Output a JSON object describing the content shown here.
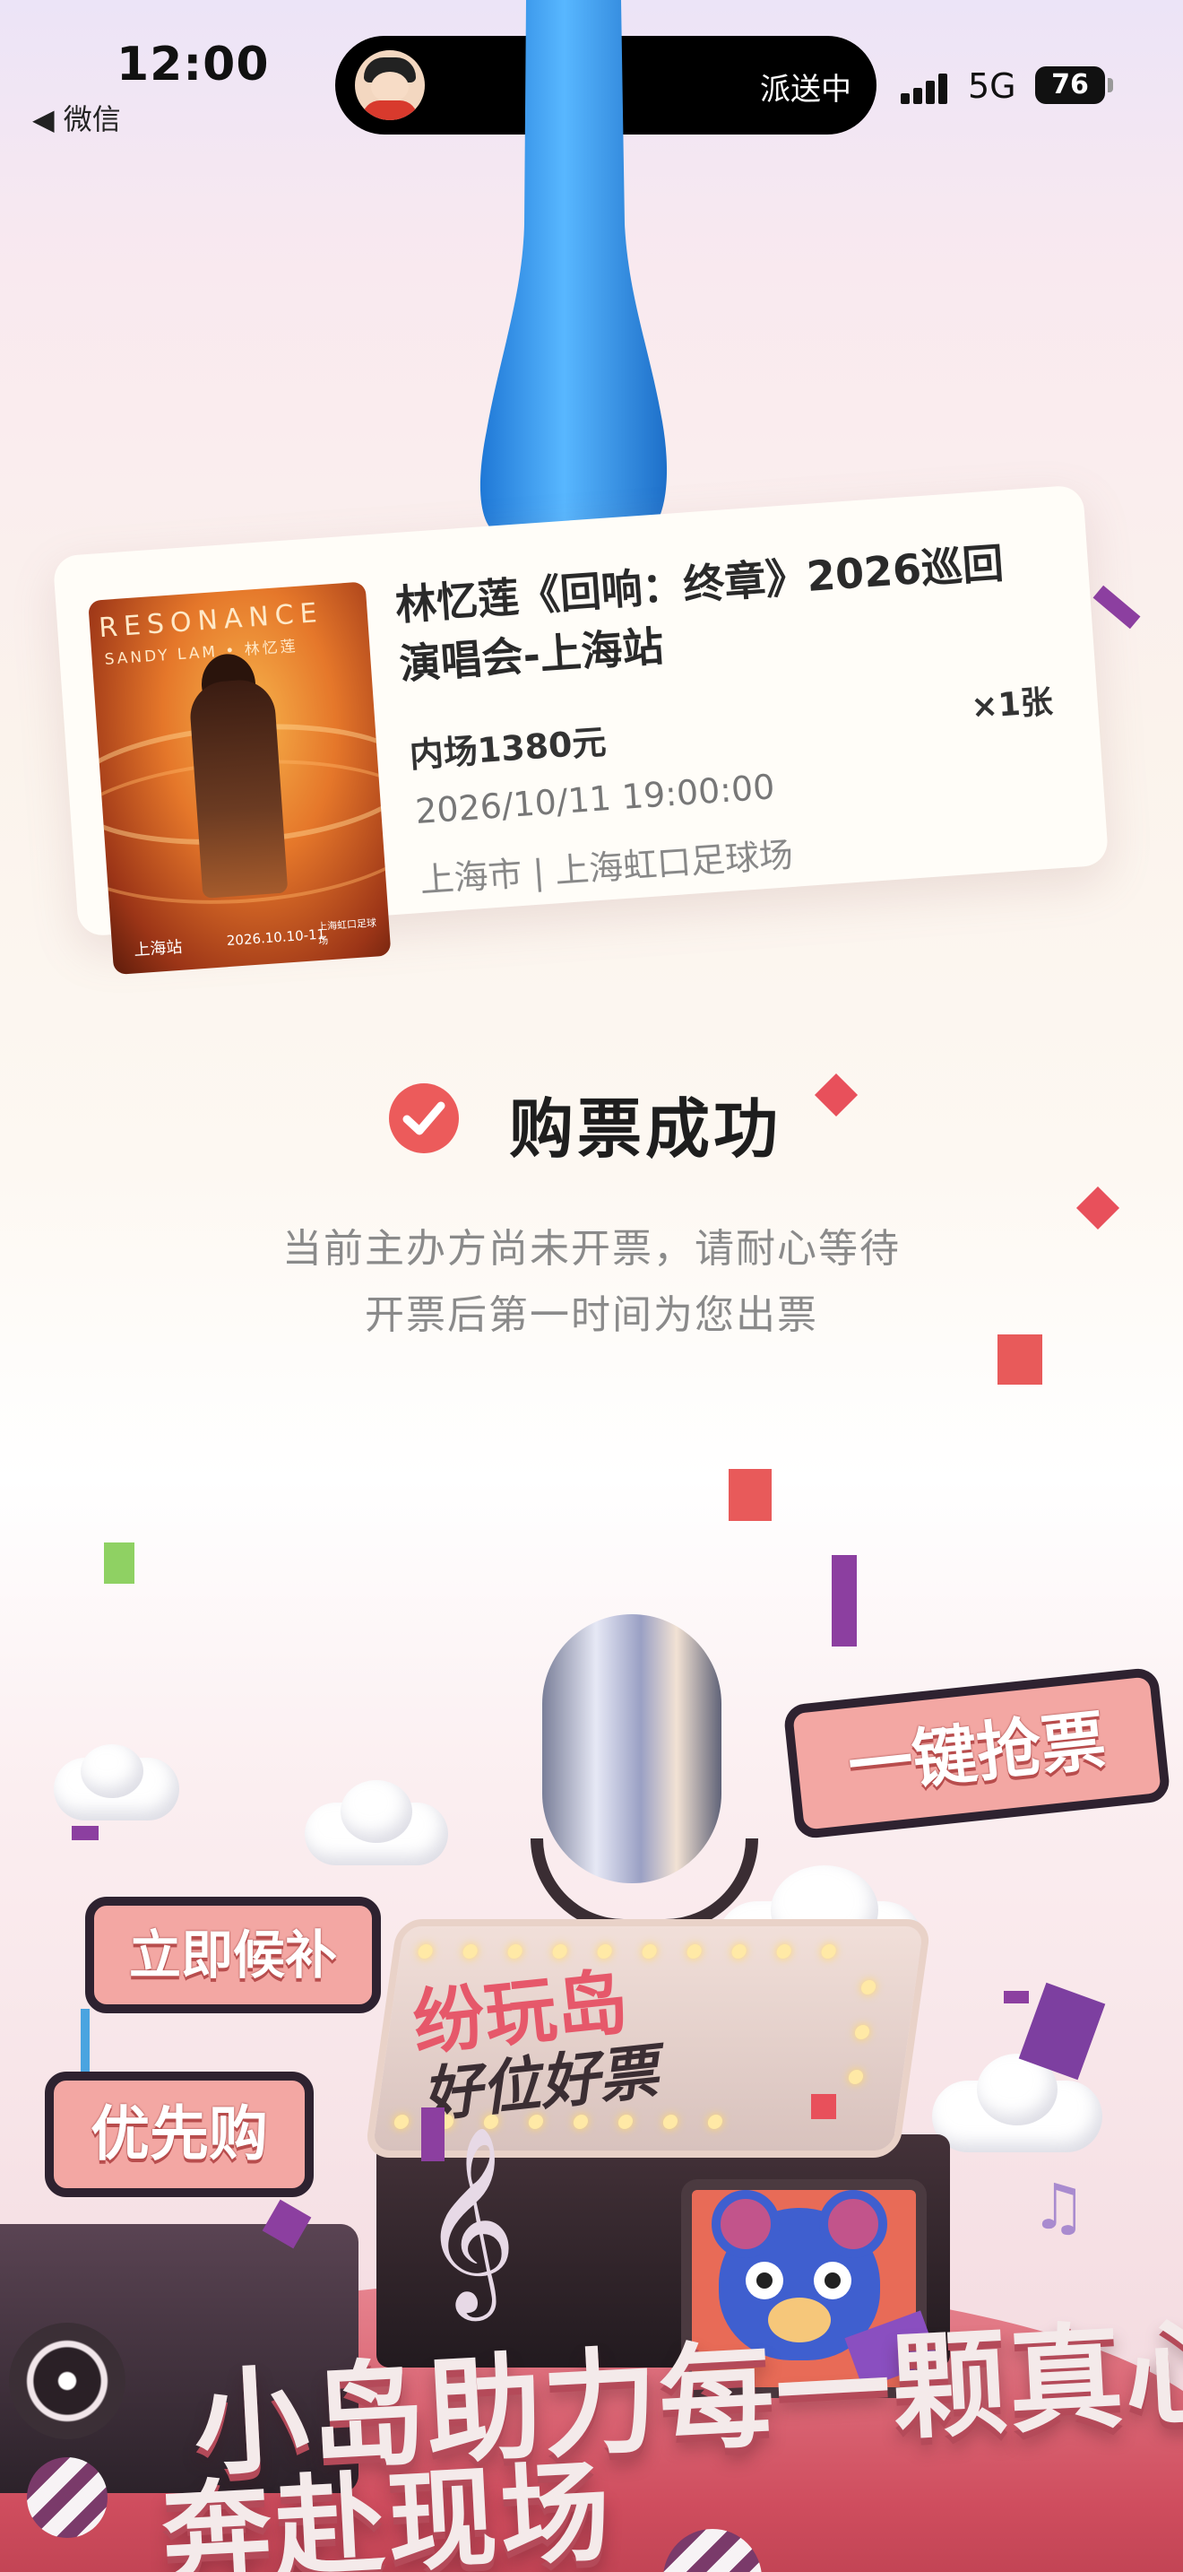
{
  "status_bar": {
    "time": "12:00",
    "back_app": "◀ 微信",
    "live_activity": "派送中",
    "network": "5G",
    "battery": "76"
  },
  "ticket": {
    "poster_title": "RESONANCE",
    "poster_artist": "SANDY LAM • 林忆莲",
    "poster_city": "上海站",
    "poster_date": "2026.10.10-11",
    "poster_venue": "上海虹口足球场",
    "title": "林忆莲《回响：终章》2026巡回演唱会-上海站",
    "quantity": "×1张",
    "tier": "内场1380元",
    "datetime": "2026/10/11 19:00:00",
    "venue": "上海市 | 上海虹口足球场"
  },
  "result": {
    "title": "购票成功",
    "message_line1": "当前主办方尚未开票，请耐心等待",
    "message_line2": "开票后第一时间为您出票"
  },
  "promo": {
    "bubble_grab": "一键抢票",
    "bubble_waitlist": "立即候补",
    "bubble_priority": "优先购",
    "marquee_line1": "纷玩岛",
    "marquee_line2": "好位好票",
    "slogan_line1": "小岛助力每一颗真心",
    "slogan_line2": "奔赴现场"
  },
  "colors": {
    "accent_red": "#ec5b5b",
    "mascot_blue": "#3b9cf0"
  }
}
